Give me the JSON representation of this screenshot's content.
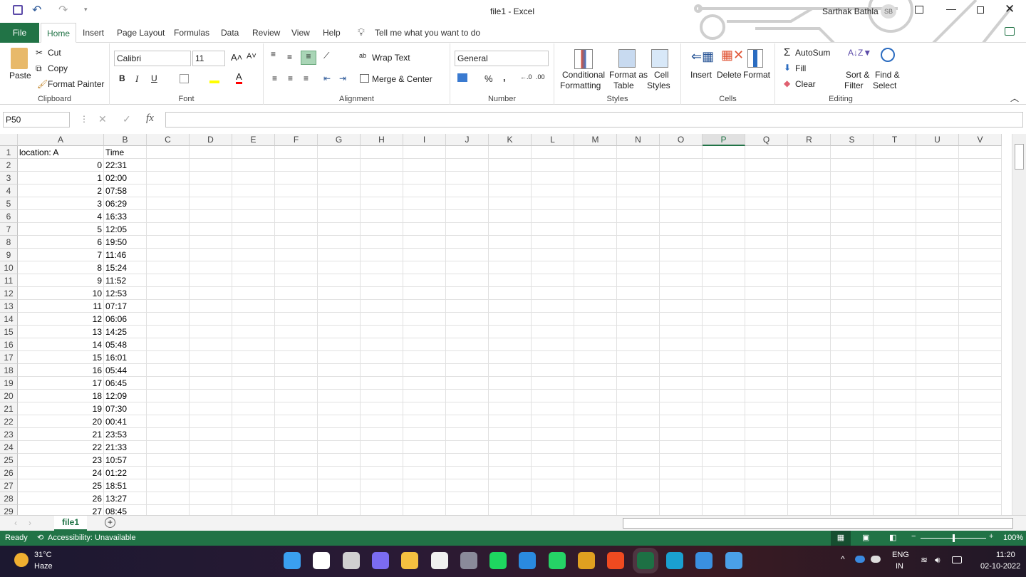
{
  "title": {
    "text": "file1  -  Excel",
    "user": "Sarthak Bathla",
    "initials": "SB"
  },
  "qat": {
    "save": "save-icon",
    "undo": "undo-icon",
    "redo": "redo-icon"
  },
  "tabs": [
    "File",
    "Home",
    "Insert",
    "Page Layout",
    "Formulas",
    "Data",
    "Review",
    "View",
    "Help"
  ],
  "tell_me": "Tell me what you want to do",
  "ribbon": {
    "clipboard": {
      "paste": "Paste",
      "cut": "Cut",
      "copy": "Copy",
      "format_painter": "Format Painter",
      "label": "Clipboard"
    },
    "font": {
      "name": "Calibri",
      "size": "11",
      "bold": "B",
      "italic": "I",
      "underline": "U",
      "label": "Font",
      "highlight_color": "#ffff00",
      "font_color": "#ff0000"
    },
    "alignment": {
      "wrap": "Wrap Text",
      "merge": "Merge & Center",
      "label": "Alignment"
    },
    "number": {
      "format": "General",
      "percent": "%",
      "comma": ",",
      "label": "Number"
    },
    "styles": {
      "conditional": [
        "Conditional",
        "Formatting"
      ],
      "format_table": [
        "Format as",
        "Table"
      ],
      "cell_styles": [
        "Cell",
        "Styles"
      ],
      "label": "Styles"
    },
    "cells": {
      "insert": "Insert",
      "delete": "Delete",
      "format": "Format",
      "label": "Cells"
    },
    "editing": {
      "autosum": "AutoSum",
      "fill": "Fill",
      "clear": "Clear",
      "sort": [
        "Sort &",
        "Filter"
      ],
      "find": [
        "Find &",
        "Select"
      ],
      "label": "Editing"
    }
  },
  "formula_bar": {
    "name_box": "P50",
    "fx": "fx",
    "value": ""
  },
  "columns": [
    "A",
    "B",
    "C",
    "D",
    "E",
    "F",
    "G",
    "H",
    "I",
    "J",
    "K",
    "L",
    "M",
    "N",
    "O",
    "P",
    "Q",
    "R",
    "S",
    "T",
    "U",
    "V"
  ],
  "selected_column": "P",
  "rows": [
    [
      "location: A",
      "Time"
    ],
    [
      "0",
      "22:31"
    ],
    [
      "1",
      "02:00"
    ],
    [
      "2",
      "07:58"
    ],
    [
      "3",
      "06:29"
    ],
    [
      "4",
      "16:33"
    ],
    [
      "5",
      "12:05"
    ],
    [
      "6",
      "19:50"
    ],
    [
      "7",
      "11:46"
    ],
    [
      "8",
      "15:24"
    ],
    [
      "9",
      "11:52"
    ],
    [
      "10",
      "12:53"
    ],
    [
      "11",
      "07:17"
    ],
    [
      "12",
      "06:06"
    ],
    [
      "13",
      "14:25"
    ],
    [
      "14",
      "05:48"
    ],
    [
      "15",
      "16:01"
    ],
    [
      "16",
      "05:44"
    ],
    [
      "17",
      "06:45"
    ],
    [
      "18",
      "12:09"
    ],
    [
      "19",
      "07:30"
    ],
    [
      "20",
      "00:41"
    ],
    [
      "21",
      "23:53"
    ],
    [
      "22",
      "21:33"
    ],
    [
      "23",
      "10:57"
    ],
    [
      "24",
      "01:22"
    ],
    [
      "25",
      "18:51"
    ],
    [
      "26",
      "13:27"
    ],
    [
      "27",
      "08:45"
    ]
  ],
  "sheet_tab": "file1",
  "status": {
    "ready": "Ready",
    "accessibility": "Accessibility: Unavailable",
    "zoom": "100%",
    "zoom_level": 100
  },
  "taskbar": {
    "temp": "31°C",
    "weather": "Haze",
    "lang1": "ENG",
    "lang2": "IN",
    "time": "11:20",
    "date": "02-10-2022",
    "apps": [
      {
        "name": "start",
        "color": "#3aa0f0"
      },
      {
        "name": "search",
        "color": "#ffffff"
      },
      {
        "name": "task-view",
        "color": "#d0d0d0"
      },
      {
        "name": "teams",
        "color": "#7b6cf0"
      },
      {
        "name": "file-explorer",
        "color": "#f5c040"
      },
      {
        "name": "store",
        "color": "#f0f0f0"
      },
      {
        "name": "settings",
        "color": "#8a8a9a"
      },
      {
        "name": "spotify",
        "color": "#1ed760"
      },
      {
        "name": "vscode",
        "color": "#2a8ae0"
      },
      {
        "name": "whatsapp",
        "color": "#25d366"
      },
      {
        "name": "chrome",
        "color": "#e0a020"
      },
      {
        "name": "brave",
        "color": "#f04a20"
      },
      {
        "name": "excel",
        "color": "#1d7044"
      },
      {
        "name": "edge",
        "color": "#1aa0d0"
      },
      {
        "name": "paint",
        "color": "#3a90e0"
      },
      {
        "name": "photos",
        "color": "#4aa0e8"
      }
    ]
  },
  "colors": {
    "accent": "#217346"
  }
}
